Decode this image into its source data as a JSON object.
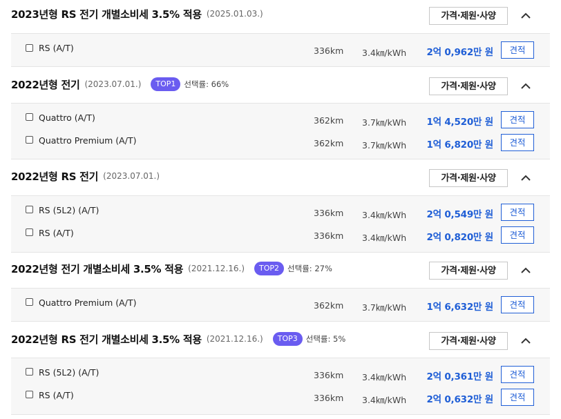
{
  "buttons": {
    "spec_label": "가격·제원·사양",
    "quote_label": "견적"
  },
  "sections": [
    {
      "title": "2023년형 RS 전기 개별소비세 3.5% 적용",
      "date": "(2025.01.03.)",
      "badge": null,
      "rate": null,
      "trims": [
        {
          "name": "RS (A/T)",
          "range": "336km",
          "efficiency": "3.4㎞/kWh",
          "price": "2억 0,962만 원"
        }
      ]
    },
    {
      "title": "2022년형 전기",
      "date": "(2023.07.01.)",
      "badge": "TOP1",
      "rate": "선택률: 66%",
      "trims": [
        {
          "name": "Quattro (A/T)",
          "range": "362km",
          "efficiency": "3.7㎞/kWh",
          "price": "1억 4,520만 원"
        },
        {
          "name": "Quattro Premium (A/T)",
          "range": "362km",
          "efficiency": "3.7㎞/kWh",
          "price": "1억 6,820만 원"
        }
      ]
    },
    {
      "title": "2022년형 RS 전기",
      "date": "(2023.07.01.)",
      "badge": null,
      "rate": null,
      "trims": [
        {
          "name": "RS (5L2) (A/T)",
          "range": "336km",
          "efficiency": "3.4㎞/kWh",
          "price": "2억 0,549만 원"
        },
        {
          "name": "RS (A/T)",
          "range": "336km",
          "efficiency": "3.4㎞/kWh",
          "price": "2억 0,820만 원"
        }
      ]
    },
    {
      "title": "2022년형 전기 개별소비세 3.5% 적용",
      "date": "(2021.12.16.)",
      "badge": "TOP2",
      "rate": "선택률: 27%",
      "trims": [
        {
          "name": "Quattro Premium (A/T)",
          "range": "362km",
          "efficiency": "3.7㎞/kWh",
          "price": "1억 6,632만 원"
        }
      ]
    },
    {
      "title": "2022년형 RS 전기 개별소비세 3.5% 적용",
      "date": "(2021.12.16.)",
      "badge": "TOP3",
      "rate": "선택률: 5%",
      "trims": [
        {
          "name": "RS (5L2) (A/T)",
          "range": "336km",
          "efficiency": "3.4㎞/kWh",
          "price": "2억 0,361만 원"
        },
        {
          "name": "RS (A/T)",
          "range": "336km",
          "efficiency": "3.4㎞/kWh",
          "price": "2억 0,632만 원"
        }
      ]
    }
  ]
}
